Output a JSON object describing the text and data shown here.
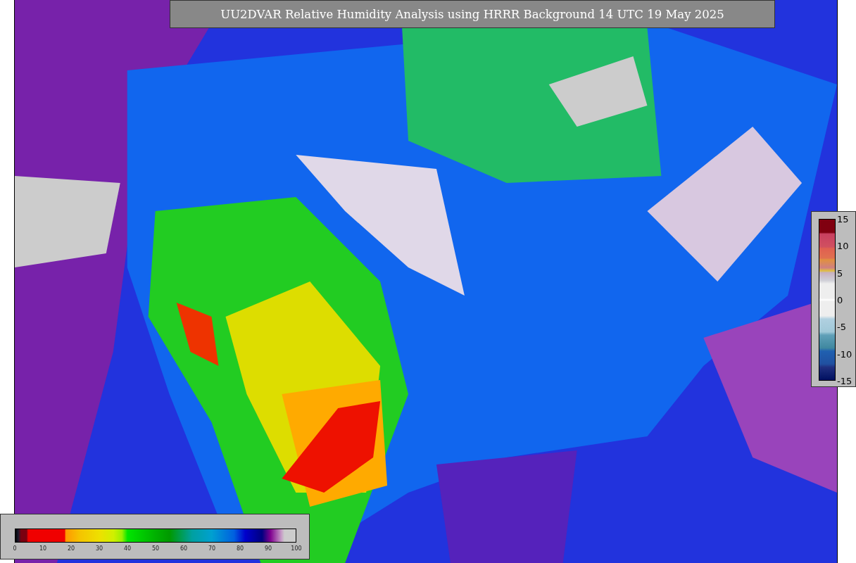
{
  "title": "UU2DVAR Relative Humidity Analysis using HRRR Background 14 UTC 19 May 2025",
  "humidity_colorbar": {
    "ticks": [
      "0",
      "10",
      "20",
      "30",
      "40",
      "50",
      "60",
      "70",
      "80",
      "90",
      "100"
    ]
  },
  "difference_colorbar": {
    "ticks": [
      "15",
      "10",
      "5",
      "0",
      "-5",
      "-10",
      "-15"
    ]
  }
}
